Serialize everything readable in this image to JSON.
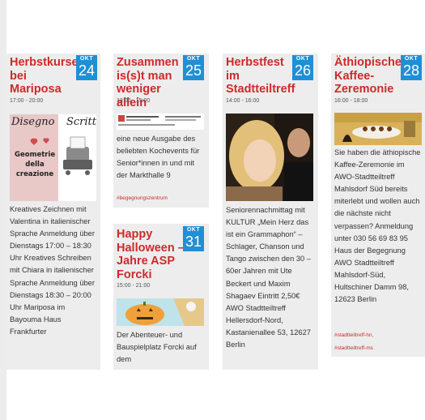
{
  "events": [
    {
      "title": "Herbstkurse bei Mariposa",
      "month": "OKT",
      "day": "24",
      "time": "17:00 - 20:00",
      "image_text": [
        "Disegno",
        "Scrittura",
        "Geometrie della creazione"
      ],
      "description": "Kreatives Zeichnen mit Valentina in italienischer Sprache Anmeldung über Dienstags 17:00 – 18:30 Uhr   Kreatives Schreiben mit Chiara in italienischer Sprache Anmeldung über Dienstags 18:30 – 20:00 Uhr Mariposa im Bayouma Haus  Frankfurter"
    },
    {
      "title": "Zusammen is(s)t man weniger allein",
      "month": "OKT",
      "day": "25",
      "time": "13:00 - 15:00",
      "description": "eine neue Ausgabe des beliebten Kochevents für Senior*innen in und mit der Markthalle 9",
      "tag": "#begegnungszentrum"
    },
    {
      "title": "Happy Halloween – 30 Jahre ASP Forcki",
      "month": "OKT",
      "day": "31",
      "time": "15:00 - 21:00",
      "description": "Der Abenteuer- und Bauspielplatz Forcki auf dem"
    },
    {
      "title": "Herbstfest im Stadtteiltreff",
      "month": "OKT",
      "day": "26",
      "time": "14:00 - 16:00",
      "description": "Seniorennachmittag mit KULTUR „Mein Herz das ist ein Grammaphon“ – Schlager, Chanson und Tango zwischen den 30 – 60er Jahren mit Ute Beckert und Maxim Shagaev Eintritt 2,50€ AWO Stadtteiltreff Hellersdorf-Nord, Kastanienallee 53, 12627 Berlin"
    },
    {
      "title": "Äthiopische Kaffee-Zeremonie",
      "month": "OKT",
      "day": "28",
      "time": "16:00 - 18:00",
      "description": "Sie haben die äthiopische Kaffee-Zeremonie im AWO-Stadtteiltreff Mahlsdorf Süd bereits miterlebt und wollen auch die nächste nicht verpassen? Anmeldung unter 030 56 69 83 95 Haus der Begegnung AWO Stadtteiltreff Mahlsdorf-Süd, Hultschiner Damm 98, 12623 Berlin",
      "tags": [
        "#stadtteiltreff-hn,",
        "#stadtteiltreff-ms"
      ]
    }
  ],
  "colors": {
    "title": "#cc2b2b",
    "datebox": "#1f8fd6",
    "card": "#ededed"
  },
  "icons": [
    "pumpkin-illustration",
    "typewriter-illustration",
    "coffee-ceremony-photo",
    "portrait-photo",
    "flyer-thumbnail"
  ]
}
